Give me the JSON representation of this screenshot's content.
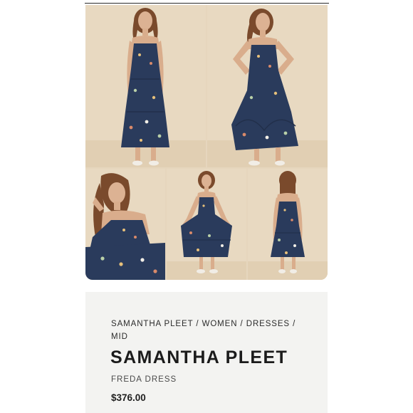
{
  "gallery": {
    "images": [
      {
        "name": "product-photo-front"
      },
      {
        "name": "product-photo-hand-on-hip"
      },
      {
        "name": "product-photo-seated"
      },
      {
        "name": "product-photo-skirt-held"
      },
      {
        "name": "product-photo-back"
      }
    ],
    "colors": {
      "background": "#e6d6bd",
      "dress": "#2a3b5c",
      "skin": "#d9ad8c",
      "hair": "#7a4a2c"
    }
  },
  "breadcrumb": {
    "items": [
      "SAMANTHA PLEET",
      "WOMEN",
      "DRESSES",
      "MID"
    ],
    "separator": " / "
  },
  "product": {
    "brand": "SAMANTHA PLEET",
    "name": "FREDA DRESS",
    "price": "$376.00"
  }
}
